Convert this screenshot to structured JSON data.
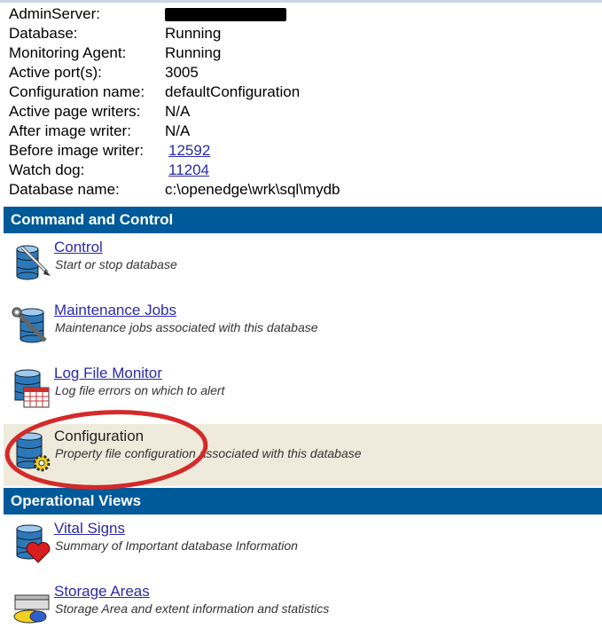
{
  "properties": [
    {
      "label": "AdminServer:",
      "value": "",
      "redacted": true
    },
    {
      "label": "Database:",
      "value": "Running"
    },
    {
      "label": "Monitoring Agent:",
      "value": "Running"
    },
    {
      "label": "Active port(s):",
      "value": "3005"
    },
    {
      "label": "Configuration name:",
      "value": "defaultConfiguration"
    },
    {
      "label": "Active page writers:",
      "value": "N/A"
    },
    {
      "label": "After image writer:",
      "value": "N/A"
    },
    {
      "label": "Before image writer:",
      "value": "12592",
      "link": true
    },
    {
      "label": "Watch dog:",
      "value": "11204",
      "link": true
    },
    {
      "label": "Database name:",
      "value": "c:\\openedge\\wrk\\sql\\mydb"
    }
  ],
  "sections": {
    "command": {
      "title": "Command and Control",
      "items": [
        {
          "title": "Control",
          "desc": "Start or stop database",
          "icon": "database-pen-icon"
        },
        {
          "title": "Maintenance Jobs",
          "desc": "Maintenance jobs associated with this database",
          "icon": "database-wrench-icon"
        },
        {
          "title": "Log File Monitor",
          "desc": "Log file errors on which to alert",
          "icon": "database-calendar-icon"
        },
        {
          "title": "Configuration",
          "desc": "Property file configuration associated with this database",
          "icon": "database-gear-icon"
        }
      ]
    },
    "operational": {
      "title": "Operational Views",
      "items": [
        {
          "title": "Vital Signs",
          "desc": "Summary of Important database Information",
          "icon": "database-heart-icon"
        },
        {
          "title": "Storage Areas",
          "desc": "Storage Area and extent information and statistics",
          "icon": "storage-disk-icon"
        }
      ]
    }
  },
  "colors": {
    "section_bg": "#005a9a",
    "highlight_bg": "#efebdc",
    "annotation": "#d42a2a",
    "link": "#2a2aa8"
  }
}
